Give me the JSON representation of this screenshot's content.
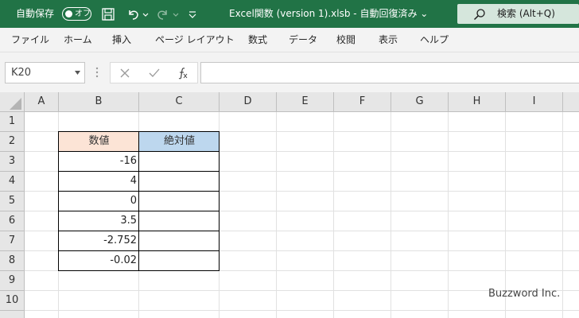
{
  "titlebar": {
    "autosave_label": "自動保存",
    "autosave_state": "オフ",
    "document_title": "Excel関数 (version 1).xlsb  -  自動回復済み ⌄",
    "search_placeholder": "検索 (Alt+Q)",
    "background_color": "#217346"
  },
  "menu": {
    "items": [
      "ファイル",
      "ホーム",
      "挿入",
      "ページ レイアウト",
      "数式",
      "データ",
      "校閲",
      "表示",
      "ヘルプ"
    ]
  },
  "formula_bar": {
    "name_box": "K20",
    "formula": ""
  },
  "sheet": {
    "columns": [
      "A",
      "B",
      "C",
      "D",
      "E",
      "F",
      "G",
      "H",
      "I"
    ],
    "rows": [
      "1",
      "2",
      "3",
      "4",
      "5",
      "6",
      "7",
      "8",
      "9",
      "10"
    ],
    "table": {
      "header_values": "数値",
      "header_abs": "絶対値",
      "header_values_color": "#fce4d6",
      "header_abs_color": "#bdd7ee",
      "values": [
        "-16",
        "4",
        "0",
        "3.5",
        "-2.752",
        "-0.02"
      ]
    }
  },
  "watermark": "Buzzword Inc."
}
